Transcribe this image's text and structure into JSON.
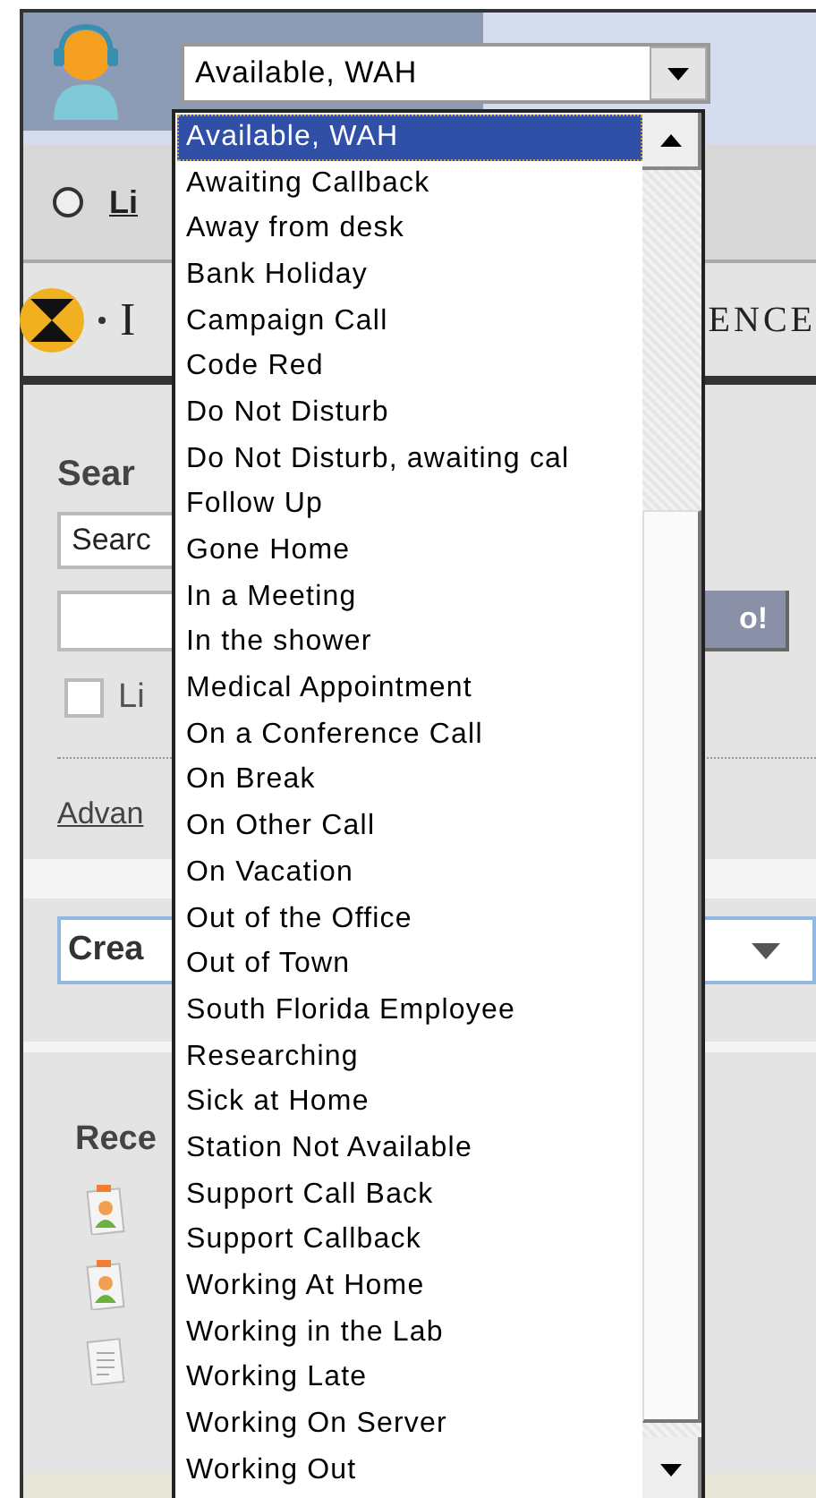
{
  "status_select": {
    "value": "Available, WAH"
  },
  "nav_link": {
    "label": "Li"
  },
  "banner": {
    "left": "I",
    "right": "ENCE"
  },
  "search": {
    "heading": "Sear",
    "scope_value": "Searc",
    "button": "o!",
    "checkbox": {
      "label": "Li",
      "checked": false
    },
    "advanced_link": "Advan"
  },
  "create_select": {
    "value": "Crea"
  },
  "recent": {
    "heading": "Rece",
    "items": [
      {
        "kind": "contact"
      },
      {
        "kind": "contact"
      },
      {
        "kind": "document"
      }
    ]
  },
  "dropdown": {
    "options": [
      {
        "label": "Available, WAH",
        "selected": true
      },
      {
        "label": "Awaiting Callback",
        "selected": false
      },
      {
        "label": "Away from desk",
        "selected": false
      },
      {
        "label": "Bank Holiday",
        "selected": false
      },
      {
        "label": "Campaign Call",
        "selected": false
      },
      {
        "label": "Code Red",
        "selected": false
      },
      {
        "label": "Do Not Disturb",
        "selected": false
      },
      {
        "label": "Do Not Disturb, awaiting cal",
        "selected": false
      },
      {
        "label": "Follow Up",
        "selected": false
      },
      {
        "label": "Gone Home",
        "selected": false
      },
      {
        "label": "In a Meeting",
        "selected": false
      },
      {
        "label": "In the shower",
        "selected": false
      },
      {
        "label": "Medical Appointment",
        "selected": false
      },
      {
        "label": "On a Conference Call",
        "selected": false
      },
      {
        "label": "On Break",
        "selected": false
      },
      {
        "label": "On Other Call",
        "selected": false
      },
      {
        "label": "On Vacation",
        "selected": false
      },
      {
        "label": "Out of the Office",
        "selected": false
      },
      {
        "label": "Out of Town",
        "selected": false
      },
      {
        "label": "South Florida Employee",
        "selected": false
      },
      {
        "label": "Researching",
        "selected": false
      },
      {
        "label": "Sick at Home",
        "selected": false
      },
      {
        "label": "Station Not Available",
        "selected": false
      },
      {
        "label": "Support Call Back",
        "selected": false
      },
      {
        "label": "Support Callback",
        "selected": false
      },
      {
        "label": "Working At Home",
        "selected": false
      },
      {
        "label": "Working in the Lab",
        "selected": false
      },
      {
        "label": "Working Late",
        "selected": false
      },
      {
        "label": "Working On Server",
        "selected": false
      },
      {
        "label": "Working Out",
        "selected": false
      }
    ]
  }
}
